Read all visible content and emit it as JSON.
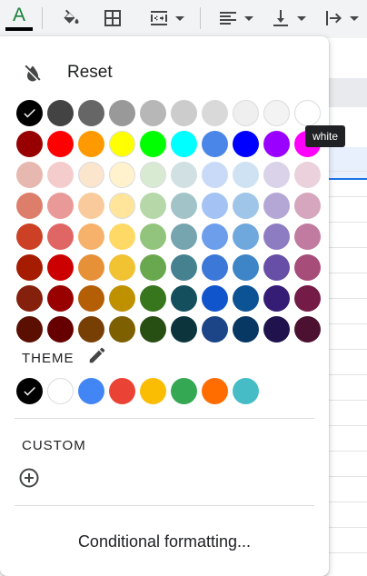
{
  "toolbar": {
    "text_color_letter": "A",
    "text_color_bar": "#000000",
    "items": [
      "fill-color",
      "borders",
      "merge-cells",
      "horizontal-align",
      "vertical-align",
      "text-wrapping"
    ]
  },
  "menu": {
    "reset_label": "Reset",
    "palette": [
      [
        "#000000",
        "#434343",
        "#666666",
        "#999999",
        "#b7b7b7",
        "#cccccc",
        "#d9d9d9",
        "#efefef",
        "#f3f3f3",
        "#ffffff"
      ],
      [
        "#980000",
        "#ff0000",
        "#ff9900",
        "#ffff00",
        "#00ff00",
        "#00ffff",
        "#4a86e8",
        "#0000ff",
        "#9900ff",
        "#ff00ff"
      ],
      [
        "#e6b8af",
        "#f4cccc",
        "#fce5cd",
        "#fff2cc",
        "#d9ead3",
        "#d0e0e3",
        "#c9daf8",
        "#cfe2f3",
        "#d9d2e9",
        "#ead1dc"
      ],
      [
        "#dd7e6b",
        "#ea9999",
        "#f9cb9c",
        "#ffe599",
        "#b6d7a8",
        "#a2c4c9",
        "#a4c2f4",
        "#9fc5e8",
        "#b4a7d6",
        "#d5a6bd"
      ],
      [
        "#cc4125",
        "#e06666",
        "#f6b26b",
        "#ffd966",
        "#93c47d",
        "#76a5af",
        "#6d9eeb",
        "#6fa8dc",
        "#8e7cc3",
        "#c27ba0"
      ],
      [
        "#a61c00",
        "#cc0000",
        "#e69138",
        "#f1c232",
        "#6aa84f",
        "#45818e",
        "#3c78d8",
        "#3d85c6",
        "#674ea7",
        "#a64d79"
      ],
      [
        "#85200c",
        "#990000",
        "#b45f06",
        "#bf9000",
        "#38761d",
        "#134f5c",
        "#1155cc",
        "#0b5394",
        "#351c75",
        "#741b47"
      ],
      [
        "#5b0f00",
        "#660000",
        "#783f04",
        "#7f6000",
        "#274e13",
        "#0c343d",
        "#1c4587",
        "#073763",
        "#20124d",
        "#4c1130"
      ]
    ],
    "selected_color": "#000000",
    "theme_label": "THEME",
    "theme_colors": [
      "#000000",
      "#ffffff",
      "#4285f4",
      "#ea4335",
      "#fbbc04",
      "#34a853",
      "#ff6d01",
      "#46bdc6"
    ],
    "custom_label": "CUSTOM",
    "conditional_label": "Conditional formatting..."
  },
  "tooltip": {
    "text": "white"
  }
}
